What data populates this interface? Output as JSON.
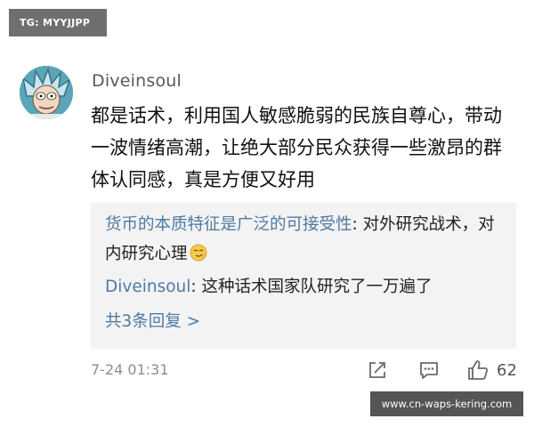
{
  "tag": {
    "text": "TG: MYYJJPP"
  },
  "post": {
    "username": "Diveinsoul",
    "avatar_icon": "cartoon-avatar",
    "text": "都是话术，利用国人敏感脆弱的民族自尊心，带动一波情绪高潮，让绝大部分民众获得一些激昂的群体认同感，真是方便又好用",
    "time": "7-24 01:31",
    "likes": "62"
  },
  "replies": [
    {
      "name": "货币的本质特征是广泛的可接受性",
      "separator": ": ",
      "text": "对外研究战术，对内研究心理",
      "emoji": "smirk-emoji"
    },
    {
      "name": "Diveinsoul",
      "separator": ": ",
      "text": "这种话术国家队研究了一万遍了"
    }
  ],
  "more_replies": "共3条回复 >",
  "icons": {
    "share": "share-icon",
    "comment": "comment-icon",
    "like": "thumbs-up-icon"
  },
  "watermark": "www.cn-waps-kering.com",
  "colors": {
    "link": "#4f7aa3",
    "reply_bg": "#f3f3f3",
    "tag_bg": "#6f6f6f",
    "watermark_bg": "#555555"
  }
}
